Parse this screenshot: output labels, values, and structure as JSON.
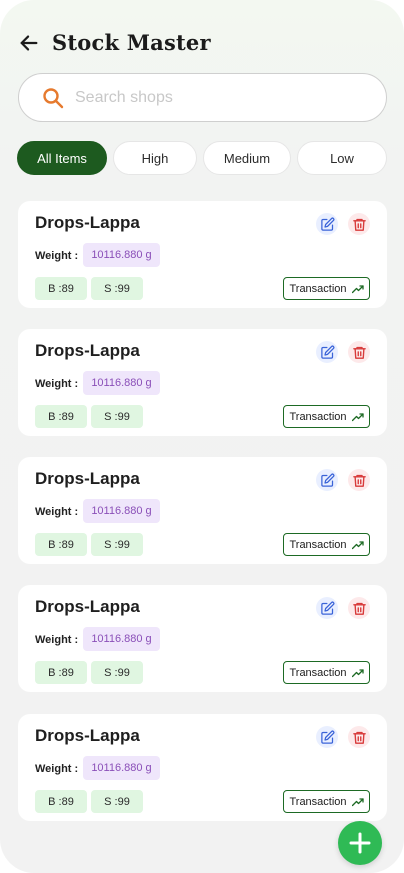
{
  "header": {
    "title": "Stock Master"
  },
  "search": {
    "placeholder": "Search shops",
    "value": ""
  },
  "filters": [
    "All Items",
    "High",
    "Medium",
    "Low"
  ],
  "active_filter": "All Items",
  "items": [
    {
      "name": "Drops-Lappa",
      "weight_label": "Weight :",
      "weight": "10116.880 g",
      "buy": "B :89",
      "sell": "S :99",
      "transaction_label": "Transaction"
    },
    {
      "name": "Drops-Lappa",
      "weight_label": "Weight :",
      "weight": "10116.880 g",
      "buy": "B :89",
      "sell": "S :99",
      "transaction_label": "Transaction"
    },
    {
      "name": "Drops-Lappa",
      "weight_label": "Weight :",
      "weight": "10116.880 g",
      "buy": "B :89",
      "sell": "S :99",
      "transaction_label": "Transaction"
    },
    {
      "name": "Drops-Lappa",
      "weight_label": "Weight :",
      "weight": "10116.880 g",
      "buy": "B :89",
      "sell": "S :99",
      "transaction_label": "Transaction"
    },
    {
      "name": "Drops-Lappa",
      "weight_label": "Weight :",
      "weight": "10116.880 g",
      "buy": "B :89",
      "sell": "S :99",
      "transaction_label": "Transaction"
    }
  ],
  "icons": {
    "back": "arrow-left-icon",
    "search": "search-icon",
    "edit": "edit-icon",
    "delete": "trash-icon",
    "transaction": "trending-up-icon",
    "add": "plus-icon"
  },
  "colors": {
    "primary": "#1d5a1f",
    "fab": "#2fba55",
    "search_icon": "#e67a2e",
    "weight_bg": "#efe6fb",
    "weight_text": "#8a4fb8",
    "badge_bg": "#e0f6e1",
    "edit": "#3a63d8",
    "delete": "#d83a3a"
  }
}
